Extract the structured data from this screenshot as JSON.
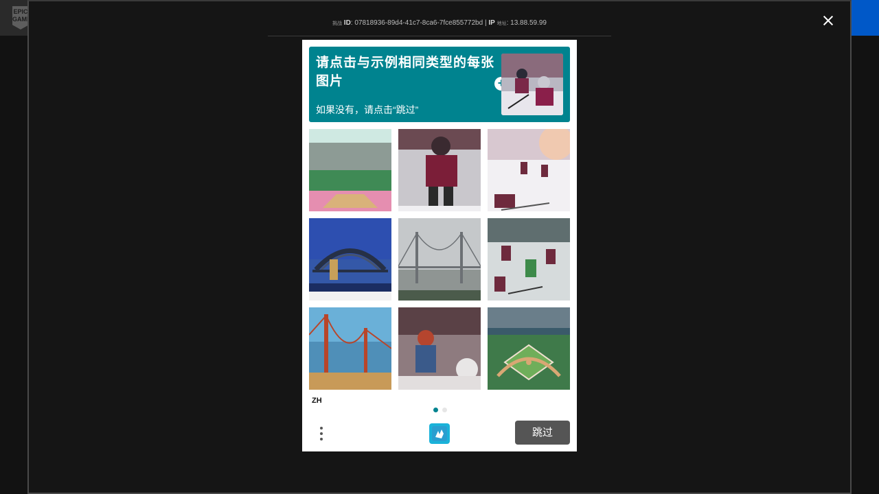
{
  "background": {
    "logo_text": "EPIC GAMES"
  },
  "modal": {
    "meta": {
      "prefix_small": "挑战",
      "id_label": "ID",
      "id_value": "07818936-89d4-41c7-8ca6-7fce855772bd",
      "separator": "|",
      "ip_label": "IP",
      "ip_small": "地址",
      "ip_value": "13.88.59.99"
    },
    "close_icon": "close-icon"
  },
  "captcha": {
    "prompt_title": "请点击与示例相同类型的每张图片",
    "prompt_subtitle": "如果没有，请点击“跳过”",
    "example_image": "ice-hockey-players",
    "tiles": [
      {
        "subject": "baseball-stadium"
      },
      {
        "subject": "hockey-player"
      },
      {
        "subject": "hockey-rink-players"
      },
      {
        "subject": "sydney-harbour-bridge"
      },
      {
        "subject": "suspension-bridge-fog"
      },
      {
        "subject": "hockey-game"
      },
      {
        "subject": "golden-gate-bridge"
      },
      {
        "subject": "hockey-goalie"
      },
      {
        "subject": "baseball-field-aerial"
      }
    ],
    "language": "ZH",
    "page_dots": 2,
    "active_page": 1,
    "submit_label": "跳过",
    "colors": {
      "accent": "#00838f",
      "submit_bg": "#555555"
    }
  }
}
